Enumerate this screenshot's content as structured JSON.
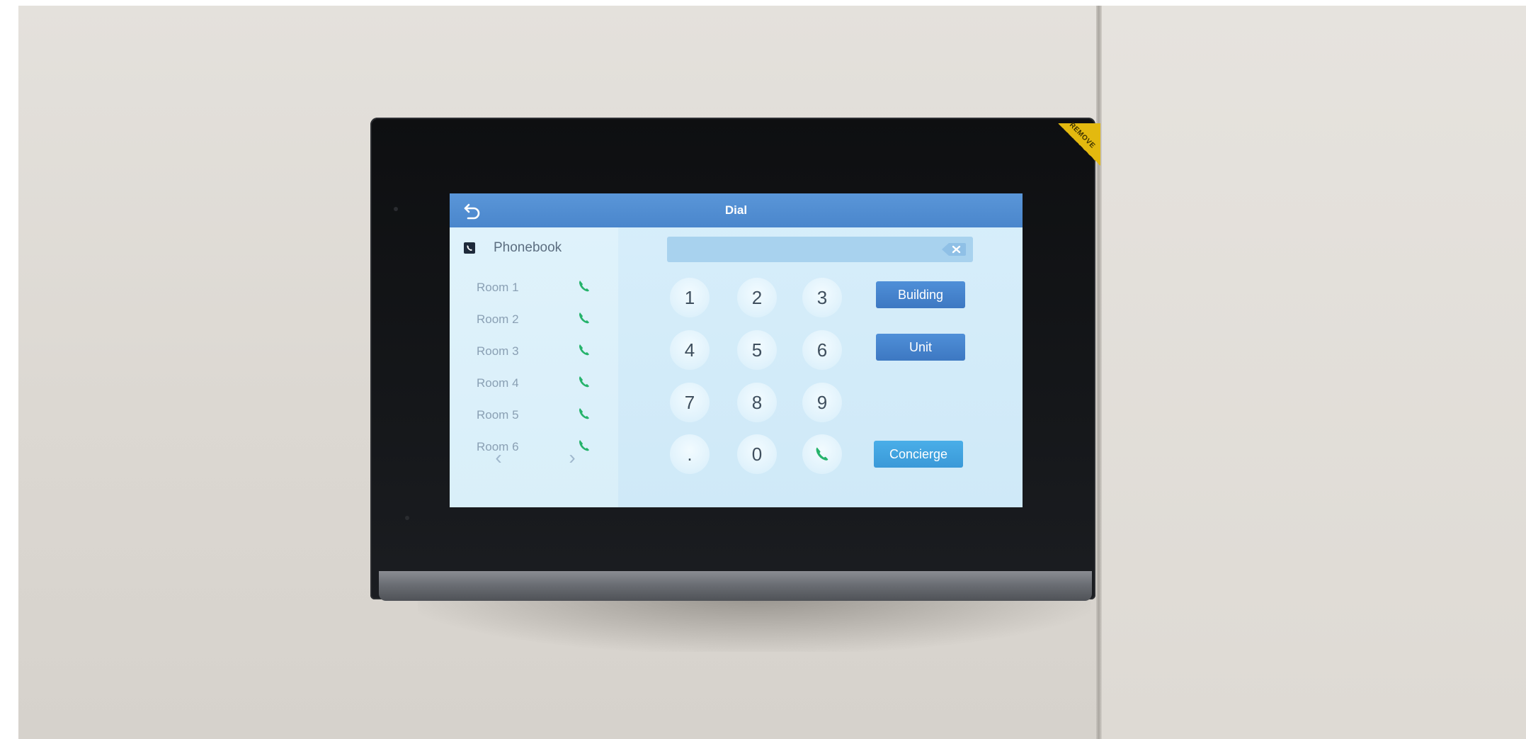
{
  "device": {
    "sticker_text": "REMOVE"
  },
  "header": {
    "title": "Dial",
    "back_icon": "back-arrow-icon"
  },
  "phonebook": {
    "label": "Phonebook",
    "icon": "phonebook-icon",
    "rooms": [
      {
        "name": "Room 1",
        "icon": "phone-call-icon"
      },
      {
        "name": "Room 2",
        "icon": "phone-call-icon"
      },
      {
        "name": "Room 3",
        "icon": "phone-call-icon"
      },
      {
        "name": "Room 4",
        "icon": "phone-call-icon"
      },
      {
        "name": "Room 5",
        "icon": "phone-call-icon"
      },
      {
        "name": "Room 6",
        "icon": "phone-call-icon"
      }
    ],
    "prev_icon": "chevron-left-icon",
    "next_icon": "chevron-right-icon",
    "prev_glyph": "‹",
    "next_glyph": "›"
  },
  "dialer": {
    "input_value": "",
    "clear_icon": "backspace-icon",
    "keys": [
      "1",
      "2",
      "3",
      "4",
      "5",
      "6",
      "7",
      "8",
      "9",
      ".",
      "0"
    ],
    "call_icon": "phone-call-icon",
    "buttons": {
      "building": "Building",
      "unit": "Unit",
      "concierge": "Concierge"
    }
  },
  "colors": {
    "titlebar": "#4a86cc",
    "button": "#3d78c2",
    "concierge": "#3a99d8",
    "call_green": "#25b36b",
    "sticker": "#e3b90f"
  }
}
